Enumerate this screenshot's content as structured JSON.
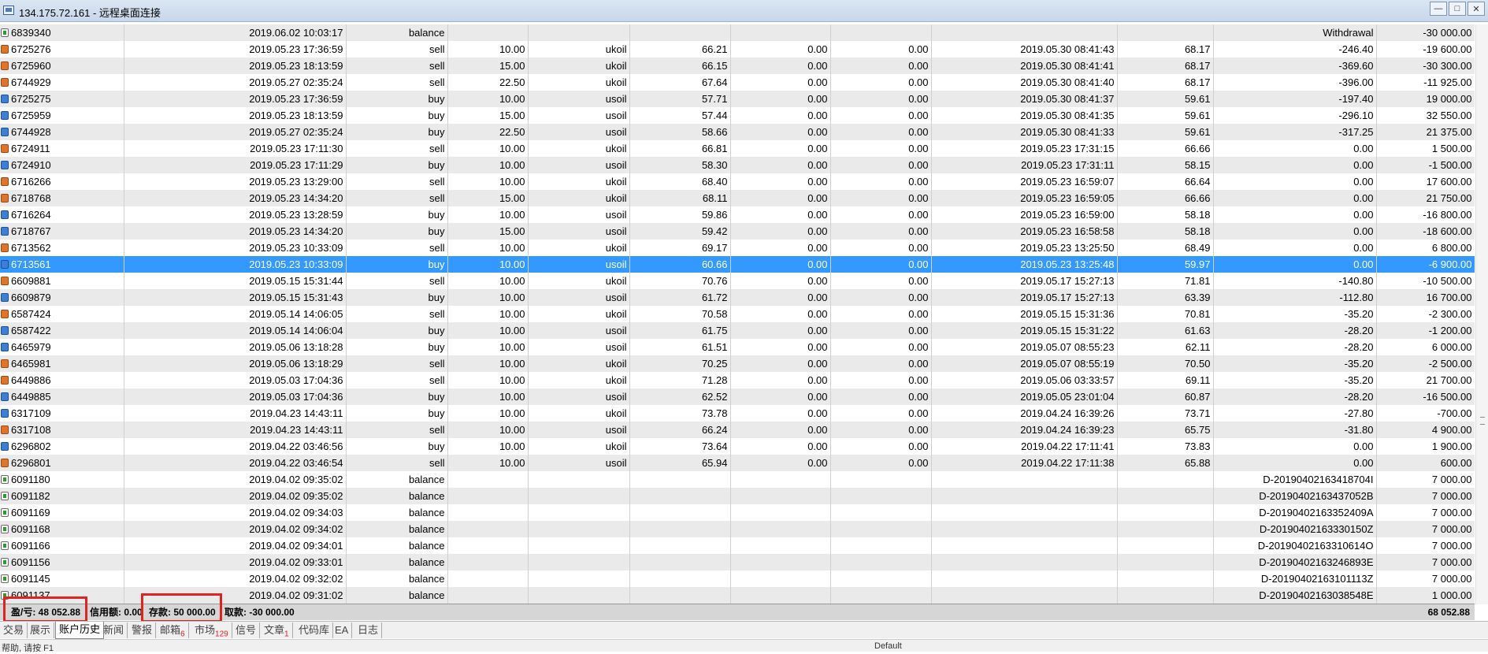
{
  "window": {
    "title": "134.175.72.161 - 远程桌面连接",
    "controls": [
      "—",
      "□",
      "✕"
    ]
  },
  "rows": [
    [
      "6839340",
      "2019.06.02 10:03:17",
      "balance",
      "",
      "",
      "",
      "",
      "",
      "",
      "",
      "Withdrawal",
      "-30 000.00"
    ],
    [
      "6725276",
      "2019.05.23 17:36:59",
      "sell",
      "10.00",
      "ukoil",
      "66.21",
      "0.00",
      "0.00",
      "2019.05.30 08:41:43",
      "68.17",
      "-246.40",
      "-19 600.00"
    ],
    [
      "6725960",
      "2019.05.23 18:13:59",
      "sell",
      "15.00",
      "ukoil",
      "66.15",
      "0.00",
      "0.00",
      "2019.05.30 08:41:41",
      "68.17",
      "-369.60",
      "-30 300.00"
    ],
    [
      "6744929",
      "2019.05.27 02:35:24",
      "sell",
      "22.50",
      "ukoil",
      "67.64",
      "0.00",
      "0.00",
      "2019.05.30 08:41:40",
      "68.17",
      "-396.00",
      "-11 925.00"
    ],
    [
      "6725275",
      "2019.05.23 17:36:59",
      "buy",
      "10.00",
      "usoil",
      "57.71",
      "0.00",
      "0.00",
      "2019.05.30 08:41:37",
      "59.61",
      "-197.40",
      "19 000.00"
    ],
    [
      "6725959",
      "2019.05.23 18:13:59",
      "buy",
      "15.00",
      "usoil",
      "57.44",
      "0.00",
      "0.00",
      "2019.05.30 08:41:35",
      "59.61",
      "-296.10",
      "32 550.00"
    ],
    [
      "6744928",
      "2019.05.27 02:35:24",
      "buy",
      "22.50",
      "usoil",
      "58.66",
      "0.00",
      "0.00",
      "2019.05.30 08:41:33",
      "59.61",
      "-317.25",
      "21 375.00"
    ],
    [
      "6724911",
      "2019.05.23 17:11:30",
      "sell",
      "10.00",
      "ukoil",
      "66.81",
      "0.00",
      "0.00",
      "2019.05.23 17:31:15",
      "66.66",
      "0.00",
      "1 500.00"
    ],
    [
      "6724910",
      "2019.05.23 17:11:29",
      "buy",
      "10.00",
      "usoil",
      "58.30",
      "0.00",
      "0.00",
      "2019.05.23 17:31:11",
      "58.15",
      "0.00",
      "-1 500.00"
    ],
    [
      "6716266",
      "2019.05.23 13:29:00",
      "sell",
      "10.00",
      "ukoil",
      "68.40",
      "0.00",
      "0.00",
      "2019.05.23 16:59:07",
      "66.64",
      "0.00",
      "17 600.00"
    ],
    [
      "6718768",
      "2019.05.23 14:34:20",
      "sell",
      "15.00",
      "ukoil",
      "68.11",
      "0.00",
      "0.00",
      "2019.05.23 16:59:05",
      "66.66",
      "0.00",
      "21 750.00"
    ],
    [
      "6716264",
      "2019.05.23 13:28:59",
      "buy",
      "10.00",
      "usoil",
      "59.86",
      "0.00",
      "0.00",
      "2019.05.23 16:59:00",
      "58.18",
      "0.00",
      "-16 800.00"
    ],
    [
      "6718767",
      "2019.05.23 14:34:20",
      "buy",
      "15.00",
      "usoil",
      "59.42",
      "0.00",
      "0.00",
      "2019.05.23 16:58:58",
      "58.18",
      "0.00",
      "-18 600.00"
    ],
    [
      "6713562",
      "2019.05.23 10:33:09",
      "sell",
      "10.00",
      "ukoil",
      "69.17",
      "0.00",
      "0.00",
      "2019.05.23 13:25:50",
      "68.49",
      "0.00",
      "6 800.00"
    ],
    [
      "6713561",
      "2019.05.23 10:33:09",
      "buy",
      "10.00",
      "usoil",
      "60.66",
      "0.00",
      "0.00",
      "2019.05.23 13:25:48",
      "59.97",
      "0.00",
      "-6 900.00"
    ],
    [
      "6609881",
      "2019.05.15 15:31:44",
      "sell",
      "10.00",
      "ukoil",
      "70.76",
      "0.00",
      "0.00",
      "2019.05.17 15:27:13",
      "71.81",
      "-140.80",
      "-10 500.00"
    ],
    [
      "6609879",
      "2019.05.15 15:31:43",
      "buy",
      "10.00",
      "usoil",
      "61.72",
      "0.00",
      "0.00",
      "2019.05.17 15:27:13",
      "63.39",
      "-112.80",
      "16 700.00"
    ],
    [
      "6587424",
      "2019.05.14 14:06:05",
      "sell",
      "10.00",
      "ukoil",
      "70.58",
      "0.00",
      "0.00",
      "2019.05.15 15:31:36",
      "70.81",
      "-35.20",
      "-2 300.00"
    ],
    [
      "6587422",
      "2019.05.14 14:06:04",
      "buy",
      "10.00",
      "usoil",
      "61.75",
      "0.00",
      "0.00",
      "2019.05.15 15:31:22",
      "61.63",
      "-28.20",
      "-1 200.00"
    ],
    [
      "6465979",
      "2019.05.06 13:18:28",
      "buy",
      "10.00",
      "usoil",
      "61.51",
      "0.00",
      "0.00",
      "2019.05.07 08:55:23",
      "62.11",
      "-28.20",
      "6 000.00"
    ],
    [
      "6465981",
      "2019.05.06 13:18:29",
      "sell",
      "10.00",
      "ukoil",
      "70.25",
      "0.00",
      "0.00",
      "2019.05.07 08:55:19",
      "70.50",
      "-35.20",
      "-2 500.00"
    ],
    [
      "6449886",
      "2019.05.03 17:04:36",
      "sell",
      "10.00",
      "ukoil",
      "71.28",
      "0.00",
      "0.00",
      "2019.05.06 03:33:57",
      "69.11",
      "-35.20",
      "21 700.00"
    ],
    [
      "6449885",
      "2019.05.03 17:04:36",
      "buy",
      "10.00",
      "usoil",
      "62.52",
      "0.00",
      "0.00",
      "2019.05.05 23:01:04",
      "60.87",
      "-28.20",
      "-16 500.00"
    ],
    [
      "6317109",
      "2019.04.23 14:43:11",
      "buy",
      "10.00",
      "ukoil",
      "73.78",
      "0.00",
      "0.00",
      "2019.04.24 16:39:26",
      "73.71",
      "-27.80",
      "-700.00"
    ],
    [
      "6317108",
      "2019.04.23 14:43:11",
      "sell",
      "10.00",
      "usoil",
      "66.24",
      "0.00",
      "0.00",
      "2019.04.24 16:39:23",
      "65.75",
      "-31.80",
      "4 900.00"
    ],
    [
      "6296802",
      "2019.04.22 03:46:56",
      "buy",
      "10.00",
      "ukoil",
      "73.64",
      "0.00",
      "0.00",
      "2019.04.22 17:11:41",
      "73.83",
      "0.00",
      "1 900.00"
    ],
    [
      "6296801",
      "2019.04.22 03:46:54",
      "sell",
      "10.00",
      "usoil",
      "65.94",
      "0.00",
      "0.00",
      "2019.04.22 17:11:38",
      "65.88",
      "0.00",
      "600.00"
    ],
    [
      "6091180",
      "2019.04.02 09:35:02",
      "balance",
      "",
      "",
      "",
      "",
      "",
      "",
      "",
      "D-20190402163418704I",
      "7 000.00"
    ],
    [
      "6091182",
      "2019.04.02 09:35:02",
      "balance",
      "",
      "",
      "",
      "",
      "",
      "",
      "",
      "D-20190402163437052B",
      "7 000.00"
    ],
    [
      "6091169",
      "2019.04.02 09:34:03",
      "balance",
      "",
      "",
      "",
      "",
      "",
      "",
      "",
      "D-20190402163352409A",
      "7 000.00"
    ],
    [
      "6091168",
      "2019.04.02 09:34:02",
      "balance",
      "",
      "",
      "",
      "",
      "",
      "",
      "",
      "D-20190402163330150Z",
      "7 000.00"
    ],
    [
      "6091166",
      "2019.04.02 09:34:01",
      "balance",
      "",
      "",
      "",
      "",
      "",
      "",
      "",
      "D-20190402163310614O",
      "7 000.00"
    ],
    [
      "6091156",
      "2019.04.02 09:33:01",
      "balance",
      "",
      "",
      "",
      "",
      "",
      "",
      "",
      "D-20190402163246893E",
      "7 000.00"
    ],
    [
      "6091145",
      "2019.04.02 09:32:02",
      "balance",
      "",
      "",
      "",
      "",
      "",
      "",
      "",
      "D-20190402163101113Z",
      "7 000.00"
    ],
    [
      "6091137",
      "2019.04.02 09:31:02",
      "balance",
      "",
      "",
      "",
      "",
      "",
      "",
      "",
      "D-20190402163038548E",
      "1 000.00"
    ]
  ],
  "selected_row": 14,
  "summary": {
    "pl": "盈/亏: 48 052.88",
    "credit": "信用额: 0.00",
    "deposit": "存款: 50 000.00",
    "withdrawal": "取款: -30 000.00",
    "total": "68 052.88"
  },
  "tabs": [
    {
      "label": "交易",
      "badge": ""
    },
    {
      "label": "展示",
      "badge": ""
    },
    {
      "label": "账户历史",
      "badge": ""
    },
    {
      "label": "新闻",
      "badge": ""
    },
    {
      "label": "警报",
      "badge": ""
    },
    {
      "label": "邮箱",
      "badge": "6"
    },
    {
      "label": "市场",
      "badge": "129"
    },
    {
      "label": "信号",
      "badge": ""
    },
    {
      "label": "文章",
      "badge": "1"
    },
    {
      "label": "代码库",
      "badge": ""
    },
    {
      "label": "EA",
      "badge": ""
    },
    {
      "label": "日志",
      "badge": ""
    }
  ],
  "active_tab": 2,
  "status": {
    "left": "帮助, 请按 F1",
    "mid": "Default"
  },
  "colors": {
    "selection": "#3399ff",
    "highlight_box": "#e0231f",
    "badge": "#d22222"
  }
}
